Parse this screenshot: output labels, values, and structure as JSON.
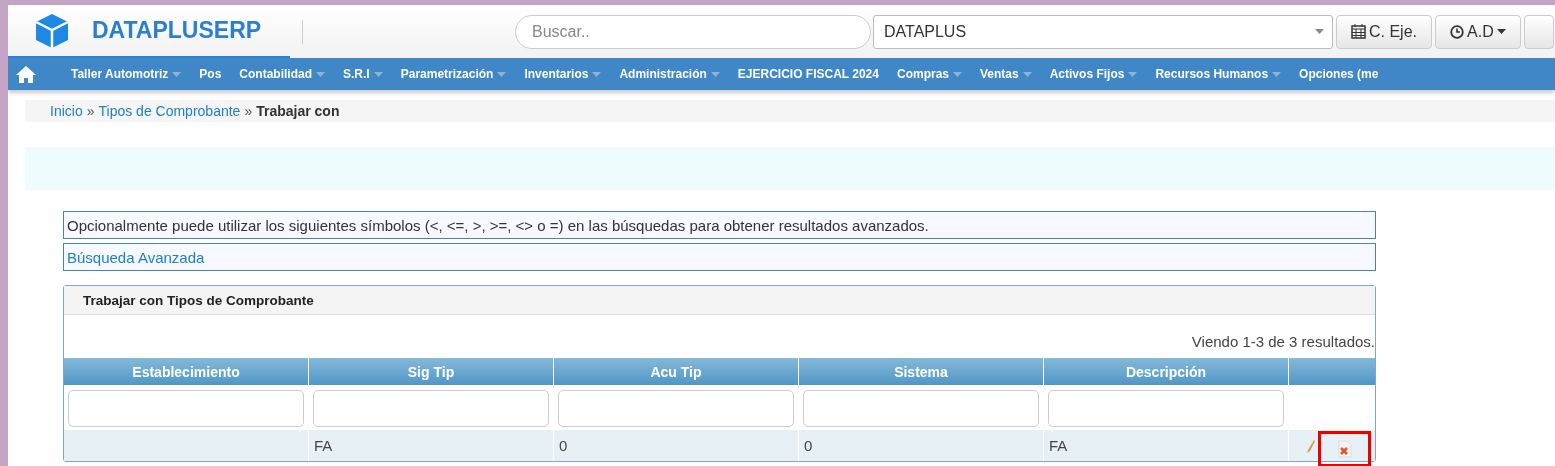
{
  "header": {
    "brand": "DATAPLUSERP",
    "search": {
      "placeholder": "Buscar.."
    },
    "company_select": {
      "value": "DATAPLUS"
    },
    "buttons": [
      {
        "label": "C. Eje.",
        "kind": "calendar"
      },
      {
        "label": "A.D",
        "kind": "clock"
      }
    ]
  },
  "nav": [
    {
      "label": "Taller Automotriz",
      "has_menu": true
    },
    {
      "label": "Pos",
      "has_menu": false
    },
    {
      "label": "Contabilidad",
      "has_menu": true
    },
    {
      "label": "S.R.I",
      "has_menu": true
    },
    {
      "label": "Parametrización",
      "has_menu": true
    },
    {
      "label": "Inventarios",
      "has_menu": true
    },
    {
      "label": "Administración",
      "has_menu": true
    },
    {
      "label": "EJERCICIO FISCAL 2024",
      "has_menu": false
    },
    {
      "label": "Compras",
      "has_menu": true
    },
    {
      "label": "Ventas",
      "has_menu": true
    },
    {
      "label": "Activos Fijos",
      "has_menu": true
    },
    {
      "label": "Recursos Humanos",
      "has_menu": true
    },
    {
      "label": "Opciones (me",
      "has_menu": false
    }
  ],
  "breadcrumb": [
    {
      "label": "Inicio",
      "link": true
    },
    {
      "separator": "»",
      "label": "Tipos de Comprobante",
      "link": true
    },
    {
      "separator": "»",
      "label": "Trabajar con",
      "link": false
    }
  ],
  "hint": "Opcionalmente puede utilizar los siguientes símbolos (<, <=, >, >=, <> o =) en las búsquedas para obtener resultados avanzados.",
  "advanced_search": "Búsqueda Avanzada",
  "panel": {
    "title": "Trabajar con Tipos de Comprobante",
    "summary": "Viendo 1-3 de 3 resultados.",
    "columns": [
      "Establecimiento",
      "Sig Tip",
      "Acu Tip",
      "Sistema",
      "Descripción"
    ],
    "rows": [
      {
        "cells": [
          "",
          "FA",
          "0",
          "0",
          "FA"
        ],
        "delete_highlighted": true
      }
    ]
  }
}
